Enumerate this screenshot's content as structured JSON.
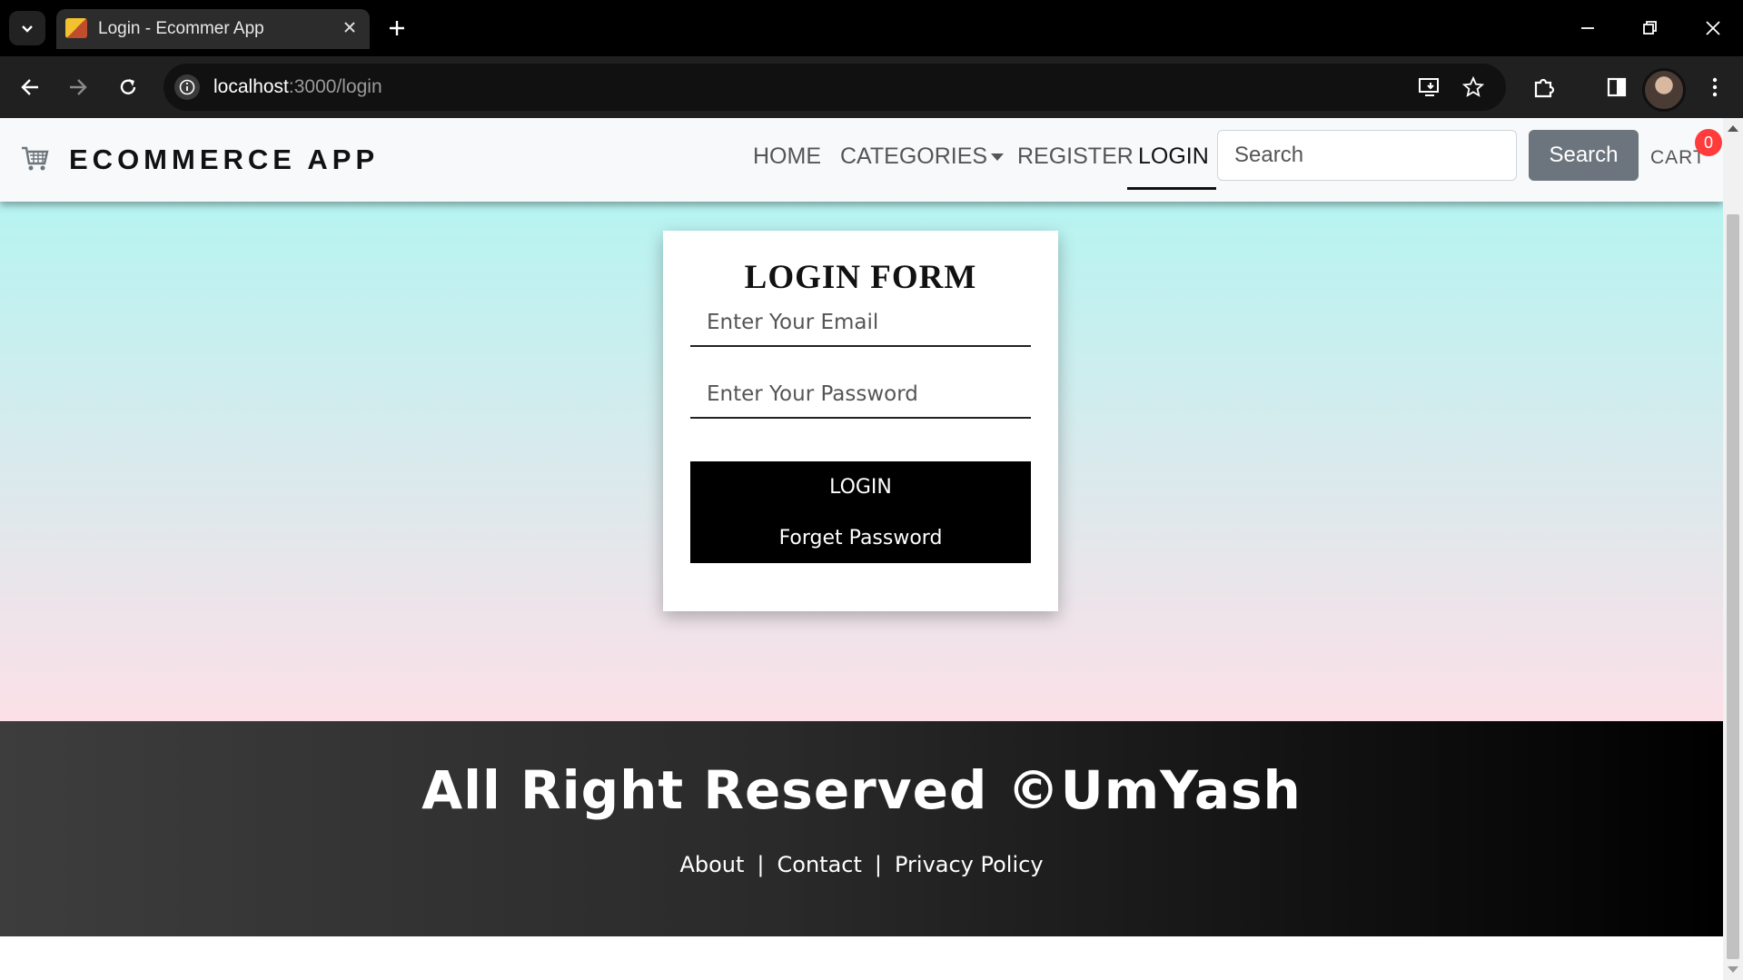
{
  "browser": {
    "tab_title": "Login - Ecommer App",
    "url_host": "localhost",
    "url_rest": ":3000/login",
    "icons": [
      "tab-search-icon",
      "close-icon",
      "plus-icon",
      "minimize-icon",
      "restore-icon",
      "close-window-icon",
      "back-icon",
      "forward-icon",
      "reload-icon",
      "info-icon",
      "install-icon",
      "star-icon",
      "extensions-icon",
      "sidepanel-icon",
      "profile-avatar",
      "more-icon"
    ]
  },
  "navbar": {
    "brand": "ECOMMERCE APP",
    "links": {
      "home": "HOME",
      "categories": "CATEGORIES",
      "register": "REGISTER",
      "login": "LOGIN"
    },
    "search_placeholder": "Search",
    "search_button": "Search",
    "cart_label": "CART",
    "cart_count": "0"
  },
  "login_form": {
    "title": "LOGIN FORM",
    "email_placeholder": "Enter Your Email",
    "password_placeholder": "Enter Your Password",
    "login_label": "LOGIN",
    "forgot_label": "Forget Password"
  },
  "footer": {
    "title": "All Right Reserved ©UmYash",
    "links": {
      "about": "About",
      "contact": "Contact",
      "privacy": "Privacy Policy"
    },
    "separator": "|"
  },
  "colors": {
    "gradient_top": "#b6f4f1",
    "gradient_bottom": "#fce0e8",
    "search_button": "#6c757d",
    "badge": "#ff3b3b"
  }
}
